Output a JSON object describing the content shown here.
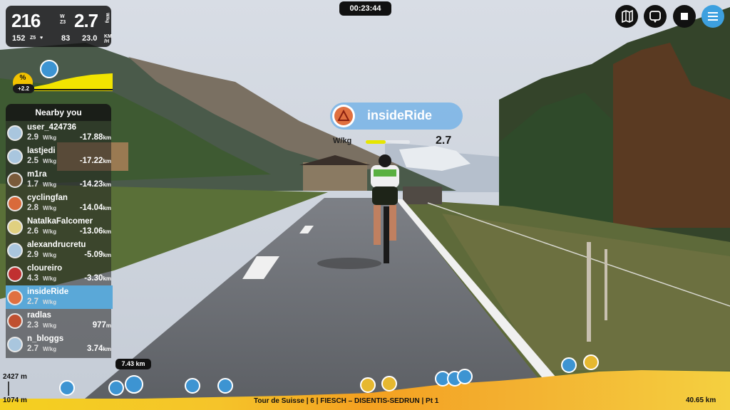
{
  "stats": {
    "power": "216",
    "power_unit": "W",
    "zone": "Z3",
    "wkg": "2.7",
    "wkg_unit": "W/kg",
    "hr": "152",
    "hr_zone": "Z5",
    "cadence": "83",
    "speed": "23.0",
    "speed_unit_top": "KM",
    "speed_unit_bottom": "/H"
  },
  "gradient": {
    "label": "%",
    "value": "+2.2"
  },
  "timer": "00:23:44",
  "nearby": {
    "title": "Nearby you",
    "riders": [
      {
        "name": "user_424736",
        "wkg": "2.9",
        "unit": "W/kg",
        "gap": "-17.88",
        "gap_unit": "km",
        "avatar": "#a9c6de",
        "me": false
      },
      {
        "name": "lastjedi",
        "wkg": "2.5",
        "unit": "W/kg",
        "gap": "-17.22",
        "gap_unit": "km",
        "avatar": "#a9c6de",
        "me": false
      },
      {
        "name": "m1ra",
        "wkg": "1.7",
        "unit": "W/kg",
        "gap": "-14.23",
        "gap_unit": "km",
        "avatar": "#7a5b3a",
        "me": false
      },
      {
        "name": "cyclingfan",
        "wkg": "2.8",
        "unit": "W/kg",
        "gap": "-14.04",
        "gap_unit": "km",
        "avatar": "#d96a3a",
        "me": false
      },
      {
        "name": "NatalkaFalcomer",
        "wkg": "2.6",
        "unit": "W/kg",
        "gap": "-13.06",
        "gap_unit": "km",
        "avatar": "#e0d080",
        "me": false
      },
      {
        "name": "alexandrucretu",
        "wkg": "2.9",
        "unit": "W/kg",
        "gap": "-5.09",
        "gap_unit": "km",
        "avatar": "#a9c6de",
        "me": false
      },
      {
        "name": "cloureiro",
        "wkg": "4.3",
        "unit": "W/kg",
        "gap": "-3.30",
        "gap_unit": "km",
        "avatar": "#c03030",
        "me": false
      },
      {
        "name": "insideRide",
        "wkg": "2.7",
        "unit": "W/kg",
        "gap": "",
        "gap_unit": "",
        "avatar": "#e07040",
        "me": true
      },
      {
        "name": "radlas",
        "wkg": "2.3",
        "unit": "W/kg",
        "gap": "977",
        "gap_unit": "m",
        "avatar": "#c05030",
        "me": false
      },
      {
        "name": "n_bloggs",
        "wkg": "2.7",
        "unit": "W/kg",
        "gap": "3.74",
        "gap_unit": "km",
        "avatar": "#a9c6de",
        "me": false
      }
    ]
  },
  "controls": {
    "map_icon": "map-icon",
    "camera_icon": "camera-switch-icon",
    "stop_icon": "stop-icon",
    "menu_icon": "menu-icon"
  },
  "rider_label": {
    "name": "insideRide",
    "wkg_label": "W/kg",
    "wkg_value": "2.7",
    "wkg_level": 0.45
  },
  "profile": {
    "max_elev": "2427 m",
    "min_elev": "1074 m",
    "distance_done": "7.43 km",
    "route": "Tour de Suisse | 6 | FIESCH – DISENTIS-SEDRUN | Pt 1",
    "total": "40.65 km"
  },
  "colors": {
    "accent": "#3da0df",
    "grade": "#f2c200"
  }
}
